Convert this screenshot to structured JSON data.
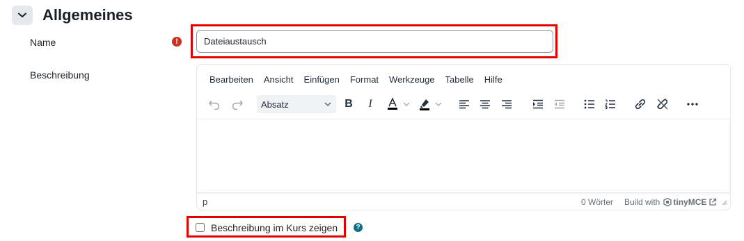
{
  "section": {
    "title": "Allgemeines",
    "collapse_icon": "chevron-down-icon"
  },
  "name_field": {
    "label": "Name",
    "value": "Dateiaustausch",
    "required_icon": "exclamation-icon",
    "required_color": "#ca3120"
  },
  "description": {
    "label": "Beschreibung",
    "menu": [
      "Bearbeiten",
      "Ansicht",
      "Einfügen",
      "Format",
      "Werkzeuge",
      "Tabelle",
      "Hilfe"
    ],
    "block_format": "Absatz",
    "status_path": "p",
    "word_count": "0 Wörter",
    "build_with": "Build with",
    "brand": "tinyMCE"
  },
  "show_description": {
    "label": "Beschreibung im Kurs zeigen",
    "checked": false,
    "help_icon": "question-icon",
    "help_color": "#0f6e8a"
  },
  "highlight_color": "#e00000"
}
